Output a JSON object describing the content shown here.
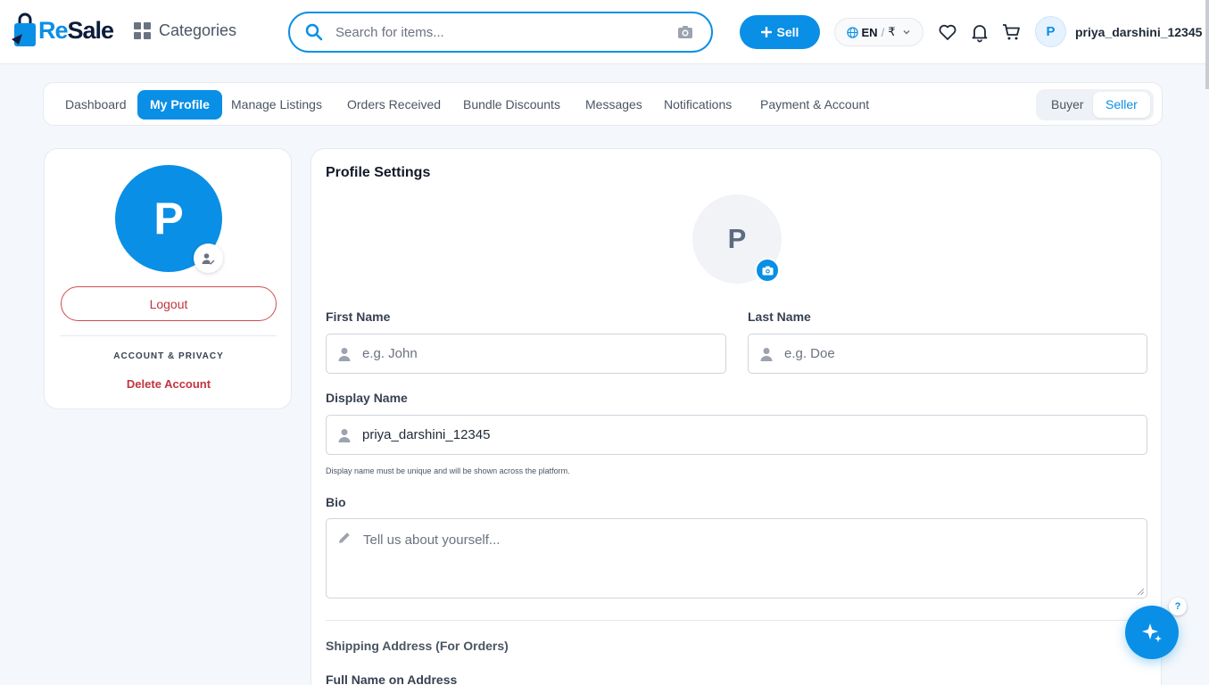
{
  "header": {
    "logo_text": "ReSale",
    "categories_label": "Categories",
    "search_placeholder": "Search for items...",
    "sell_label": "Sell",
    "language": "EN",
    "currency": "₹",
    "user_initial": "P",
    "username": "priya_darshini_12345",
    "icons": [
      "grid-icon",
      "search-icon",
      "camera-icon",
      "plus-icon",
      "globe-icon",
      "chevron-down-icon",
      "heart-icon",
      "bell-icon",
      "cart-icon"
    ]
  },
  "tabs": {
    "items": [
      {
        "label": "Dashboard"
      },
      {
        "label": "My Profile"
      },
      {
        "label": "Manage Listings"
      },
      {
        "label": "Orders Received"
      },
      {
        "label": "Bundle Discounts"
      },
      {
        "label": "Messages"
      },
      {
        "label": "Notifications"
      },
      {
        "label": "Payment & Account"
      }
    ],
    "active": "My Profile",
    "roles": [
      "Buyer",
      "Seller"
    ],
    "active_role": "Seller"
  },
  "sidebar": {
    "avatar_initial": "P",
    "logout_label": "Logout",
    "section_label": "ACCOUNT & PRIVACY",
    "delete_label": "Delete Account"
  },
  "profile": {
    "title": "Profile Settings",
    "avatar_initial": "P",
    "first_name_label": "First Name",
    "first_name_placeholder": "e.g. John",
    "last_name_label": "Last Name",
    "last_name_placeholder": "e.g. Doe",
    "display_name_label": "Display Name",
    "display_name_value": "priya_darshini_12345",
    "display_name_hint": "Display name must be unique and will be shown across the platform.",
    "bio_label": "Bio",
    "bio_placeholder": "Tell us about yourself...",
    "shipping_title": "Shipping Address (For Orders)",
    "full_name_label": "Full Name on Address"
  },
  "floating": {
    "help_label": "?"
  },
  "colors": {
    "primary": "#0a8fe6",
    "danger": "#c0343f",
    "background": "#f4f7fb"
  }
}
